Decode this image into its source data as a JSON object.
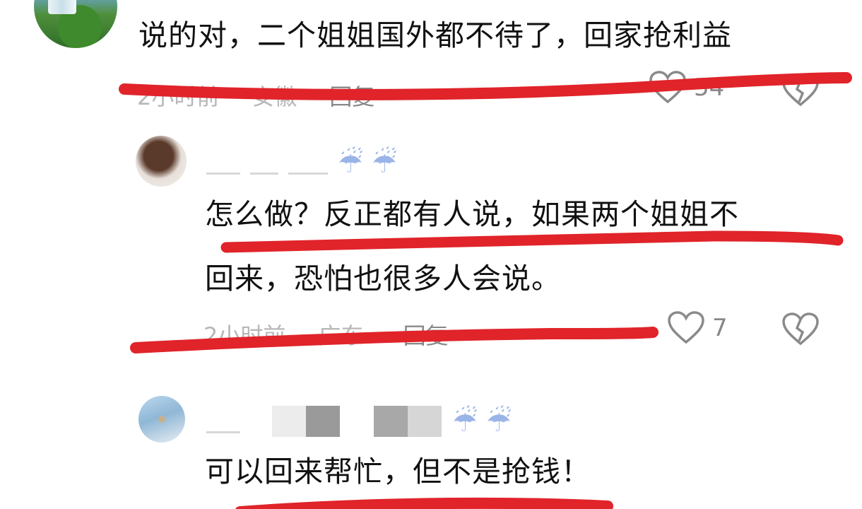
{
  "comments": [
    {
      "text": "说的对，二个姐姐国外都不待了，回家抢利益",
      "time": "2小时前",
      "location": "安徽",
      "reply": "回复",
      "likes": "54"
    },
    {
      "text_line1": "怎么做？反正都有人说，如果两个姐姐不",
      "text_line2": "回来，恐怕也很多人会说。",
      "time": "2小时前",
      "separator": "·",
      "location": "广东",
      "reply": "回复",
      "likes": "7"
    },
    {
      "text": "可以回来帮忙，但不是抢钱！"
    }
  ],
  "icons": {
    "like": "heart-outline-icon",
    "dislike": "broken-heart-icon",
    "umbrella": "umbrella-rain-emoji"
  },
  "colors": {
    "annotation_line": "#e0242a",
    "meta_text": "#b8b8b8",
    "body_text": "#111111"
  }
}
